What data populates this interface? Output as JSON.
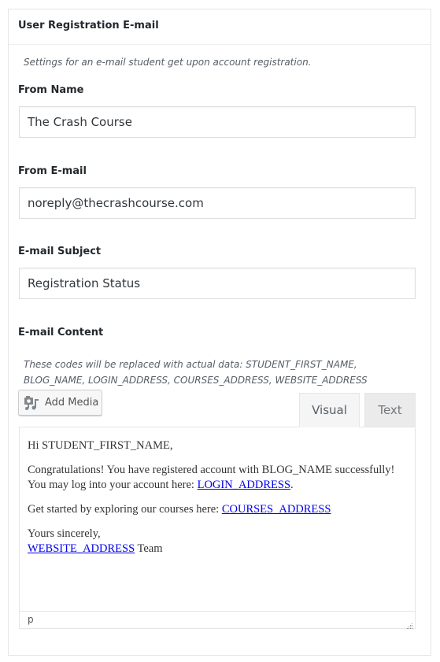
{
  "panel": {
    "title": "User Registration E-mail",
    "description": "Settings for an e-mail student get upon account registration."
  },
  "fields": {
    "from_name": {
      "label": "From Name",
      "value": "The Crash Course"
    },
    "from_email": {
      "label": "From E-mail",
      "value": "noreply@thecrashcourse.com"
    },
    "subject": {
      "label": "E-mail Subject",
      "value": "Registration Status"
    }
  },
  "content": {
    "label": "E-mail Content",
    "codes_description": "These codes will be replaced with actual data: STUDENT_FIRST_NAME, BLOG_NAME, LOGIN_ADDRESS, COURSES_ADDRESS, WEBSITE_ADDRESS",
    "add_media_label": "Add Media",
    "add_media_icon": "media-icon",
    "tabs": [
      {
        "label": "Visual",
        "active": true
      },
      {
        "label": "Text",
        "active": false
      }
    ],
    "body": {
      "greeting": "Hi STUDENT_FIRST_NAME,",
      "para1_text": "Congratulations! You have registered account with BLOG_NAME successfully! You may log into your account here: ",
      "para1_link": "LOGIN_ADDRESS",
      "para1_end": ".",
      "para2_text": "Get started by exploring our courses here: ",
      "para2_link": "COURSES_ADDRESS",
      "closing": "Yours sincerely,",
      "signature_link": "WEBSITE_ADDRESS",
      "signature_text": " Team"
    },
    "status_path": "p"
  },
  "colors": {
    "link": "#0000ee",
    "border": "#e5e5e5",
    "text": "#23282d"
  }
}
